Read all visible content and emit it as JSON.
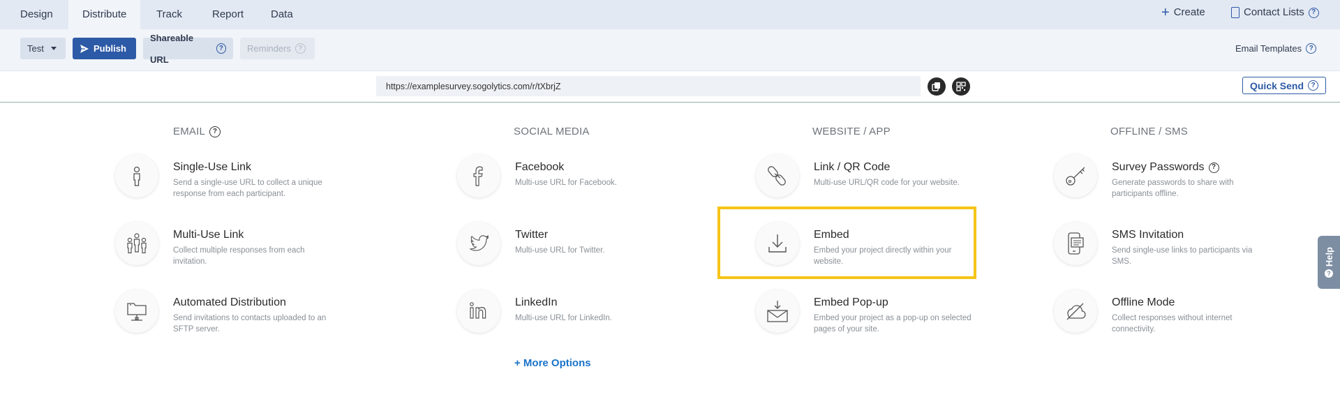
{
  "tabs": [
    {
      "label": "Design"
    },
    {
      "label": "Distribute"
    },
    {
      "label": "Track"
    },
    {
      "label": "Report"
    },
    {
      "label": "Data"
    }
  ],
  "header_right": {
    "create_label": "Create",
    "contact_lists_label": "Contact Lists"
  },
  "toolbar": {
    "test_label": "Test",
    "publish_label": "Publish",
    "shareable_url_label": "Shareable URL",
    "reminders_label": "Reminders",
    "email_templates_label": "Email Templates"
  },
  "url_bar": {
    "value": "https://examplesurvey.sogolytics.com/r/tXbrjZ",
    "quick_send_label": "Quick Send"
  },
  "columns": {
    "email": {
      "heading": "EMAIL",
      "items": [
        {
          "title": "Single-Use Link",
          "desc": "Send a single-use URL to collect a unique response from each participant.",
          "icon": "person-icon"
        },
        {
          "title": "Multi-Use Link",
          "desc": "Collect multiple responses from each invitation.",
          "icon": "people-icon"
        },
        {
          "title": "Automated Distribution",
          "desc": "Send invitations to contacts uploaded to an SFTP server.",
          "icon": "folder-network-icon"
        }
      ]
    },
    "social": {
      "heading": "SOCIAL MEDIA",
      "items": [
        {
          "title": "Facebook",
          "desc": "Multi-use URL for Facebook.",
          "icon": "facebook-icon"
        },
        {
          "title": "Twitter",
          "desc": "Multi-use URL for Twitter.",
          "icon": "twitter-icon"
        },
        {
          "title": "LinkedIn",
          "desc": "Multi-use URL for LinkedIn.",
          "icon": "linkedin-icon"
        }
      ],
      "more_options": "+ More Options"
    },
    "website": {
      "heading": "WEBSITE / APP",
      "items": [
        {
          "title": "Link / QR Code",
          "desc": "Multi-use URL/QR code for your website.",
          "icon": "link-icon"
        },
        {
          "title": "Embed",
          "desc": "Embed your project directly within your website.",
          "icon": "download-icon"
        },
        {
          "title": "Embed Pop-up",
          "desc": "Embed your project as a pop-up on selected pages of your site.",
          "icon": "envelope-download-icon"
        }
      ]
    },
    "offline": {
      "heading": "OFFLINE / SMS",
      "items": [
        {
          "title": "Survey Passwords",
          "desc": "Generate passwords to share with participants offline.",
          "icon": "key-icon"
        },
        {
          "title": "SMS Invitation",
          "desc": "Send single-use links to participants via SMS.",
          "icon": "phone-message-icon"
        },
        {
          "title": "Offline Mode",
          "desc": "Collect responses without internet connectivity.",
          "icon": "cloud-off-icon"
        }
      ]
    }
  },
  "help_tab": {
    "label": "Help"
  },
  "colors": {
    "primary": "#2d5aa6",
    "highlight": "#f6c417",
    "link": "#1a73c9"
  }
}
